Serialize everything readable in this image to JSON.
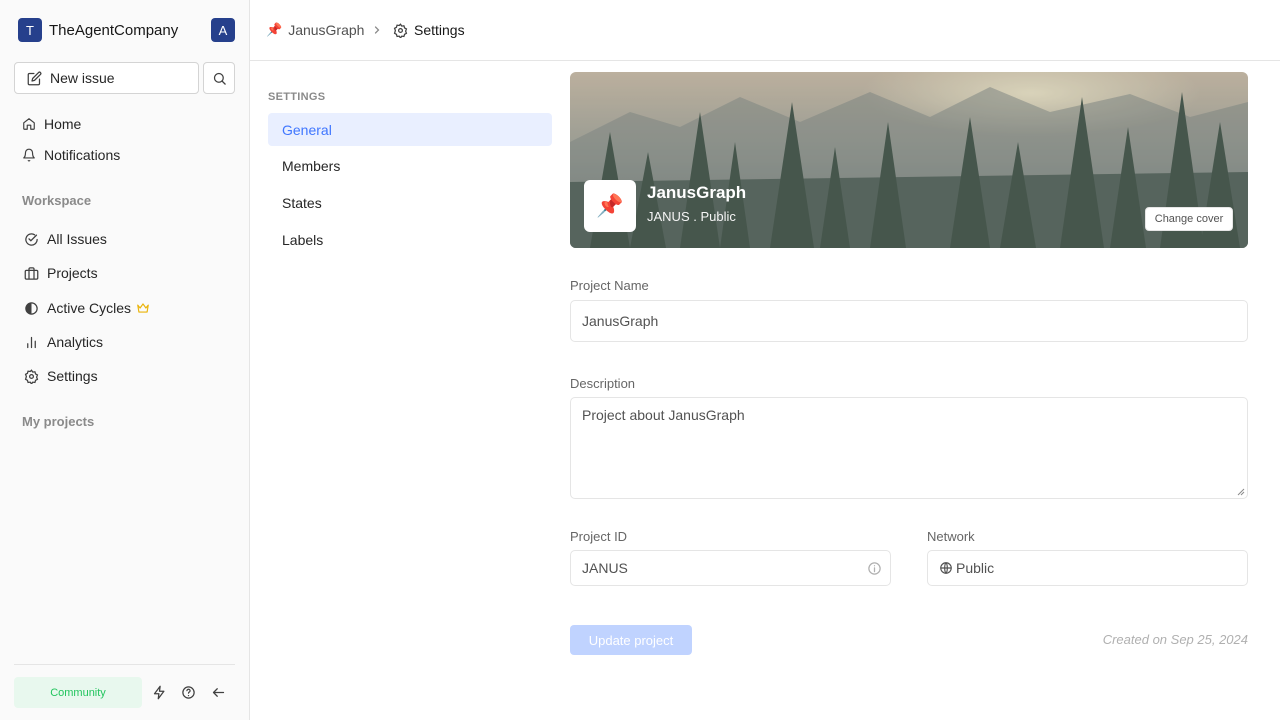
{
  "workspace": {
    "logo_letter": "T",
    "name": "TheAgentCompany",
    "avatar_letter": "A"
  },
  "sidebar": {
    "new_issue_label": "New issue",
    "top_items": [
      {
        "label": "Home",
        "icon": "home-icon"
      },
      {
        "label": "Notifications",
        "icon": "bell-icon"
      }
    ],
    "workspace_label": "Workspace",
    "workspace_items": [
      {
        "label": "All Issues",
        "icon": "check-circle-icon"
      },
      {
        "label": "Projects",
        "icon": "briefcase-icon"
      },
      {
        "label": "Active Cycles",
        "icon": "contrast-icon",
        "badge": "crown-icon"
      },
      {
        "label": "Analytics",
        "icon": "bar-chart-icon"
      },
      {
        "label": "Settings",
        "icon": "gear-icon"
      }
    ],
    "my_projects_label": "My projects",
    "community_label": "Community"
  },
  "breadcrumb": {
    "project": "JanusGraph",
    "page": "Settings"
  },
  "settings_nav": {
    "section_label": "SETTINGS",
    "items": [
      {
        "label": "General",
        "active": true
      },
      {
        "label": "Members",
        "active": false
      },
      {
        "label": "States",
        "active": false
      },
      {
        "label": "Labels",
        "active": false
      }
    ]
  },
  "project": {
    "emoji": "📌",
    "name": "JanusGraph",
    "subtitle": "JANUS .  Public",
    "change_cover_label": "Change cover"
  },
  "form": {
    "name_label": "Project Name",
    "name_value": "JanusGraph",
    "description_label": "Description",
    "description_value": "Project about JanusGraph",
    "id_label": "Project ID",
    "id_value": "JANUS",
    "network_label": "Network",
    "network_value": "Public",
    "update_label": "Update project",
    "created_text": "Created on Sep 25, 2024"
  },
  "colors": {
    "accent": "#3f76ff",
    "brand": "#26408c",
    "active_bg": "#e9efff",
    "community_green": "#22c55e"
  }
}
